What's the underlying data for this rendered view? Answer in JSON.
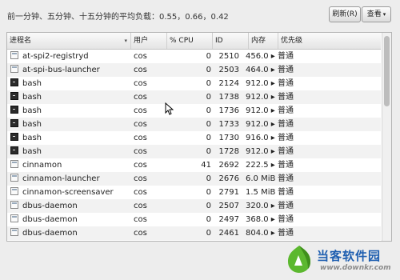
{
  "load_label": "前一分钟、五分钟、十五分钟的平均负载：0.55，0.66，0.42",
  "toolbar": {
    "refresh_label": "刷新(R)",
    "view_label": "查看",
    "view_caret": "▾"
  },
  "table": {
    "columns": [
      "进程名",
      "用户",
      "% CPU",
      "ID",
      "内存",
      "优先级"
    ],
    "sort_indicator": "▾",
    "rows": [
      {
        "name": "at-spi2-registryd",
        "icon": "app-icon",
        "user": "cos",
        "cpu": "0",
        "id": "2510",
        "memory": "456.0 ▸",
        "priority": "普通"
      },
      {
        "name": "at-spi-bus-launcher",
        "icon": "app-icon",
        "user": "cos",
        "cpu": "0",
        "id": "2503",
        "memory": "464.0 ▸",
        "priority": "普通"
      },
      {
        "name": "bash",
        "icon": "terminal-icon",
        "user": "cos",
        "cpu": "0",
        "id": "2124",
        "memory": "912.0 ▸",
        "priority": "普通"
      },
      {
        "name": "bash",
        "icon": "terminal-icon",
        "user": "cos",
        "cpu": "0",
        "id": "1738",
        "memory": "912.0 ▸",
        "priority": "普通"
      },
      {
        "name": "bash",
        "icon": "terminal-icon",
        "user": "cos",
        "cpu": "0",
        "id": "1736",
        "memory": "912.0 ▸",
        "priority": "普通"
      },
      {
        "name": "bash",
        "icon": "terminal-icon",
        "user": "cos",
        "cpu": "0",
        "id": "1733",
        "memory": "912.0 ▸",
        "priority": "普通"
      },
      {
        "name": "bash",
        "icon": "terminal-icon",
        "user": "cos",
        "cpu": "0",
        "id": "1730",
        "memory": "916.0 ▸",
        "priority": "普通"
      },
      {
        "name": "bash",
        "icon": "terminal-icon",
        "user": "cos",
        "cpu": "0",
        "id": "1728",
        "memory": "912.0 ▸",
        "priority": "普通"
      },
      {
        "name": "cinnamon",
        "icon": "app-icon",
        "user": "cos",
        "cpu": "41",
        "id": "2692",
        "memory": "222.5 ▸",
        "priority": "普通"
      },
      {
        "name": "cinnamon-launcher",
        "icon": "app-icon",
        "user": "cos",
        "cpu": "0",
        "id": "2676",
        "memory": "6.0 MiB",
        "priority": "普通"
      },
      {
        "name": "cinnamon-screensaver",
        "icon": "app-icon",
        "user": "cos",
        "cpu": "0",
        "id": "2791",
        "memory": "1.5 MiB",
        "priority": "普通"
      },
      {
        "name": "dbus-daemon",
        "icon": "app-icon",
        "user": "cos",
        "cpu": "0",
        "id": "2507",
        "memory": "320.0 ▸",
        "priority": "普通"
      },
      {
        "name": "dbus-daemon",
        "icon": "app-icon",
        "user": "cos",
        "cpu": "0",
        "id": "2497",
        "memory": "368.0 ▸",
        "priority": "普通"
      },
      {
        "name": "dbus-daemon",
        "icon": "app-icon",
        "user": "cos",
        "cpu": "0",
        "id": "2461",
        "memory": "804.0 ▸",
        "priority": "普通"
      }
    ]
  },
  "scroll_position": 0.0,
  "watermark": {
    "title": "当客软件园",
    "url": "www.downkr.com"
  },
  "colors": {
    "watermark_blue": "#1f5fb0",
    "watermark_green": "#5cb82f"
  }
}
